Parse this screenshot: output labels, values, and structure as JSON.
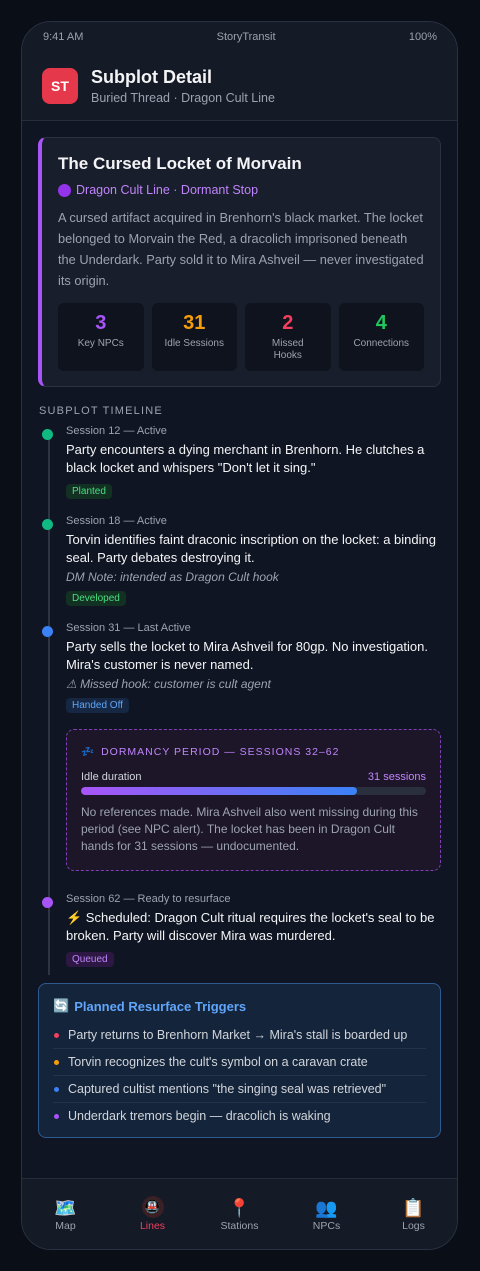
{
  "status": {
    "time": "9:41 AM",
    "carrier": "StoryTransit",
    "battery": "100%"
  },
  "header": {
    "logo": "ST",
    "title": "Subplot Detail",
    "subtitle": "Buried Thread · Dragon Cult Line"
  },
  "card": {
    "title": "The Cursed Locket of Morvain",
    "line": "Dragon Cult Line · Dormant Stop",
    "description": "A cursed artifact acquired in Brenhorn's black market. The locket belonged to Morvain the Red, a dracolich imprisoned beneath the Underdark. Party sold it to Mira Ashveil — never investigated its origin.",
    "stats": [
      {
        "value": "3",
        "label": "Key NPCs",
        "color": "#a855f7"
      },
      {
        "value": "31",
        "label": "Idle Sessions",
        "color": "#f59e0b"
      },
      {
        "value": "2",
        "label": "Missed Hooks",
        "color": "#f43f5e"
      },
      {
        "value": "4",
        "label": "Connections",
        "color": "#22c55e"
      }
    ]
  },
  "timeline": {
    "label": "SUBPLOT TIMELINE",
    "events": [
      {
        "meta": "Session 12 — Active",
        "text": "Party encounters a dying merchant in Brenhorn. He clutches a black locket and whispers \"Don't let it sing.\"",
        "note": "",
        "tag": "Planted",
        "dot_color": "#10b981"
      },
      {
        "meta": "Session 18 — Active",
        "text": "Torvin identifies faint draconic inscription on the locket: a binding seal. Party debates destroying it.",
        "note": "DM Note: intended as Dragon Cult hook",
        "tag": "Developed",
        "dot_color": "#10b981"
      },
      {
        "meta": "Session 31 — Last Active",
        "text": "Party sells the locket to Mira Ashveil for 80gp. No investigation. Mira's customer is never named.",
        "note": "⚠ Missed hook: customer is cult agent",
        "tag": "Handed Off",
        "dot_color": "#3b82f6"
      },
      {
        "meta": "Session 62 — Ready to resurface",
        "text": "⚡ Scheduled: Dragon Cult ritual requires the locket's seal to be broken. Party will discover Mira was murdered.",
        "note": "",
        "tag": "Queued",
        "dot_color": "#a855f7"
      }
    ],
    "dormancy": {
      "title": "DORMANCY PERIOD — SESSIONS 32–62",
      "idle_label": "Idle duration",
      "idle_value": "31 sessions",
      "progress": 0.8,
      "text": "No references made. Mira Ashveil also went missing during this period (see NPC alert). The locket has been in Dragon Cult hands for 31 sessions — undocumented."
    }
  },
  "triggers": {
    "title": "Planned Resurface Triggers",
    "items": [
      {
        "text": "Party returns to Brenhorn Market → Mira's stall is boarded up",
        "color": "#f43f5e"
      },
      {
        "text": "Torvin recognizes the cult's symbol on a caravan crate",
        "color": "#f59e0b"
      },
      {
        "text": "Captured cultist mentions \"the singing seal was retrieved\"",
        "color": "#3b82f6"
      },
      {
        "text": "Underdark tremors begin — dracolich is waking",
        "color": "#a855f7"
      }
    ]
  },
  "tabs": [
    {
      "label": "Map",
      "icon": "🗺️"
    },
    {
      "label": "Lines",
      "icon": "🚇"
    },
    {
      "label": "Stations",
      "icon": "📍"
    },
    {
      "label": "NPCs",
      "icon": "👥"
    },
    {
      "label": "Logs",
      "icon": "📋"
    }
  ]
}
